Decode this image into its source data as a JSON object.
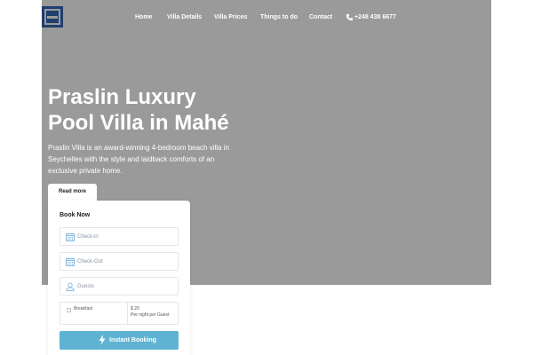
{
  "nav": {
    "items": [
      "Home",
      "Villa Details",
      "Villa Prices",
      "Things to do",
      "Contact"
    ],
    "phone": "+248 438 6677"
  },
  "hero": {
    "title_line1": "Praslin Luxury",
    "title_line2": "Pool Villa in Mahé",
    "desc_line1": "Praslin Villa is an award-winning 4-bedroom beach villa in",
    "desc_line2": "Seychelles with the style and laidback comforts of an",
    "desc_line3": "exclusive private home.",
    "read_more": "Read more"
  },
  "booking": {
    "title": "Book Now",
    "checkin_placeholder": "Check-in",
    "checkout_placeholder": "Check-Out",
    "guests_placeholder": "Guests",
    "breakfast_label": "Breakfast",
    "breakfast_price": "$ 20",
    "breakfast_note": "Per night per Guest",
    "submit_label": "Instant Booking"
  },
  "colors": {
    "hero_bg": "#9a9a9a",
    "accent": "#5fb3d2",
    "logo": "#1f3f6e",
    "icon": "#6fa8d6"
  },
  "icons": {
    "logo": "site-logo",
    "phone": "phone-icon",
    "calendar": "calendar-icon",
    "user": "user-icon",
    "bolt": "lightning-icon"
  }
}
